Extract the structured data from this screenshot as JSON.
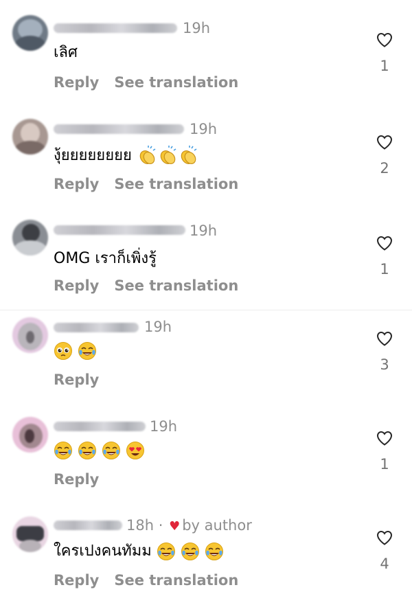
{
  "comments": [
    {
      "time": "19h",
      "text": "เลิศ",
      "reply": "Reply",
      "translate": "See translation",
      "likes": "1",
      "emojis": []
    },
    {
      "time": "19h",
      "text": "งุ้ยยยยยยยย",
      "reply": "Reply",
      "translate": "See translation",
      "likes": "2",
      "emojis": [
        "clapping-hands",
        "clapping-hands",
        "clapping-hands"
      ]
    },
    {
      "time": "19h",
      "text": "OMG เราก็เพิ่งรู้",
      "reply": "Reply",
      "translate": "See translation",
      "likes": "1",
      "emojis": []
    },
    {
      "time": "19h",
      "text": "",
      "reply": "Reply",
      "translate": "",
      "likes": "3",
      "emojis": [
        "pleading-face",
        "tears-of-joy"
      ]
    },
    {
      "time": "19h",
      "text": "",
      "reply": "Reply",
      "translate": "",
      "likes": "1",
      "emojis": [
        "tears-of-joy",
        "tears-of-joy",
        "tears-of-joy",
        "heart-eyes"
      ]
    },
    {
      "time": "18h",
      "author_tag": "by author",
      "text": "ใครเปงคนทัมม",
      "reply": "Reply",
      "translate": "See translation",
      "likes": "4",
      "emojis": [
        "tears-of-joy",
        "tears-of-joy",
        "tears-of-joy"
      ]
    }
  ],
  "colors": {
    "muted": "#8e8e8e",
    "heart_red": "#e0263a",
    "emoji_yellow": "#f7c531"
  }
}
